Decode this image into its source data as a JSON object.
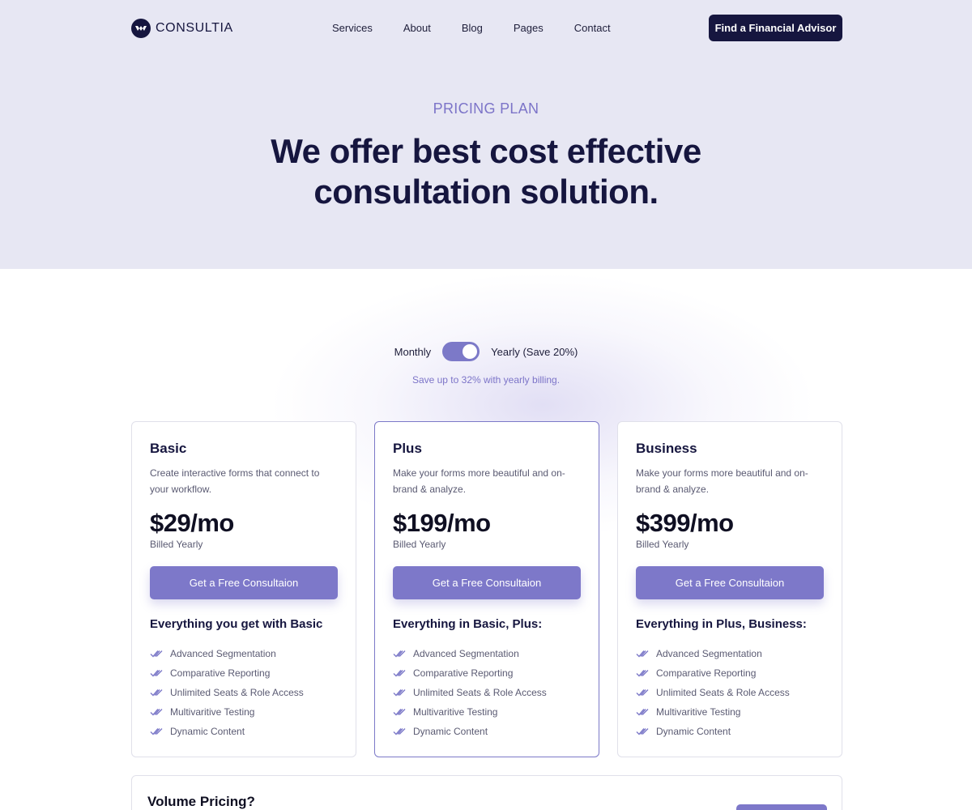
{
  "brand": {
    "name": "CONSULTIA"
  },
  "nav": {
    "links": [
      "Services",
      "About",
      "Blog",
      "Pages",
      "Contact"
    ],
    "cta": "Find a Financial Advisor"
  },
  "hero": {
    "eyebrow": "PRICING PLAN",
    "headline_line1": "We offer best cost effective",
    "headline_line2": "consultation solution."
  },
  "billing_toggle": {
    "monthly_label": "Monthly",
    "yearly_label": "Yearly (Save 20%)",
    "selected": "Yearly",
    "note": "Save up to 32% with yearly billing."
  },
  "plans": [
    {
      "name": "Basic",
      "description": "Create interactive forms that connect to your workflow.",
      "price": "$29/mo",
      "billing": "Billed Yearly",
      "button": "Get a Free Consultaion",
      "features_title": "Everything you get with Basic",
      "features": [
        "Advanced Segmentation",
        "Comparative Reporting",
        "Unlimited Seats & Role Access",
        "Multivaritive Testing",
        "Dynamic Content"
      ],
      "featured": false
    },
    {
      "name": "Plus",
      "description": "Make your forms more beautiful and on-brand & analyze.",
      "price": "$199/mo",
      "billing": "Billed Yearly",
      "button": "Get a Free Consultaion",
      "features_title": "Everything in Basic, Plus:",
      "features": [
        "Advanced Segmentation",
        "Comparative Reporting",
        "Unlimited Seats & Role Access",
        "Multivaritive Testing",
        "Dynamic Content"
      ],
      "featured": true
    },
    {
      "name": "Business",
      "description": "Make your forms more beautiful and on-brand & analyze.",
      "price": "$399/mo",
      "billing": "Billed Yearly",
      "button": "Get a Free Consultaion",
      "features_title": "Everything in Plus, Business:",
      "features": [
        "Advanced Segmentation",
        "Comparative Reporting",
        "Unlimited Seats & Role Access",
        "Multivaritive Testing",
        "Dynamic Content"
      ],
      "featured": false
    }
  ],
  "volume": {
    "title": "Volume Pricing?"
  },
  "colors": {
    "navy": "#16163f",
    "accent": "#7d78c9",
    "hero_bg": "#e7e7f3"
  },
  "icons": {
    "logo": "consultia-logo-icon",
    "check": "double-check-icon"
  }
}
